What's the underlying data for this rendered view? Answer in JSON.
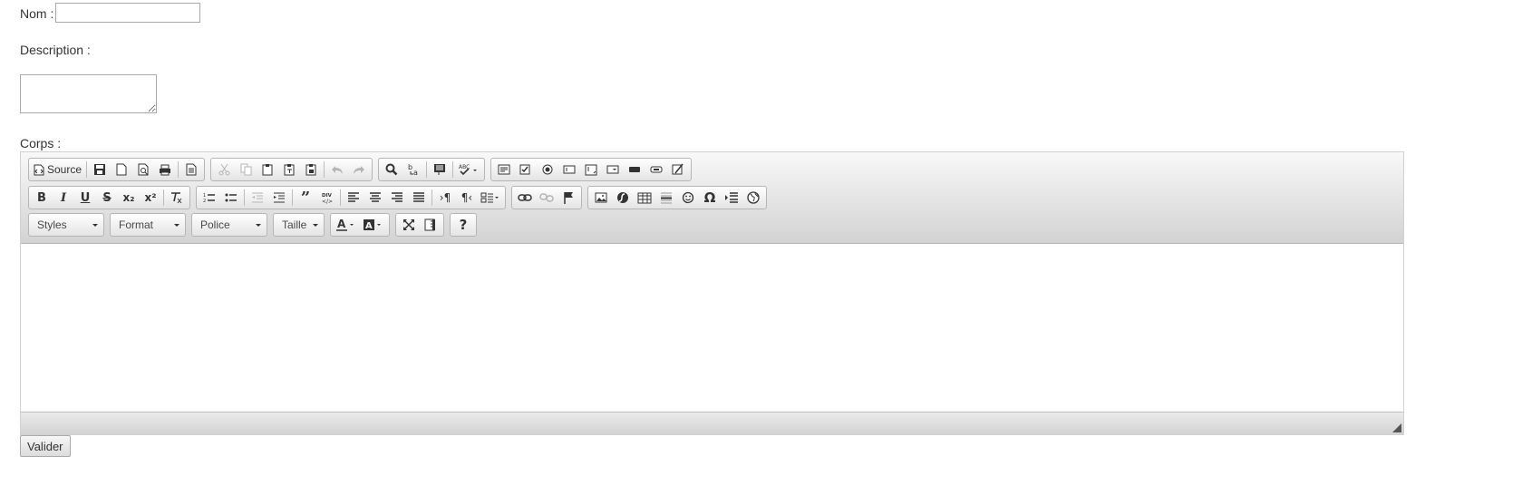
{
  "form": {
    "nom_label": "Nom :",
    "nom_value": "",
    "description_label": "Description :",
    "description_value": "",
    "corps_label": "Corps :",
    "submit_label": "Valider"
  },
  "editor": {
    "toolbar": {
      "source_label": "Source",
      "combos": {
        "styles": "Styles",
        "format": "Format",
        "police": "Police",
        "taille": "Taille"
      },
      "subscript_glyph": "x₂",
      "superscript_glyph": "x²",
      "omega_glyph": "Ω",
      "help_glyph": "?"
    },
    "icons": [
      "source-icon",
      "save-icon",
      "new-page-icon",
      "preview-icon",
      "print-icon",
      "templates-icon",
      "cut-icon",
      "copy-icon",
      "paste-icon",
      "paste-text-icon",
      "paste-word-icon",
      "undo-icon",
      "redo-icon",
      "find-icon",
      "replace-icon",
      "select-all-icon",
      "spellcheck-icon",
      "form-icon",
      "checkbox-icon",
      "radio-icon",
      "text-field-icon",
      "textarea-icon",
      "select-icon",
      "button-icon",
      "image-button-icon",
      "hidden-field-icon",
      "bold-icon",
      "italic-icon",
      "underline-icon",
      "strike-icon",
      "subscript-icon",
      "superscript-icon",
      "remove-format-icon",
      "numbered-list-icon",
      "bulleted-list-icon",
      "outdent-icon",
      "indent-icon",
      "blockquote-icon",
      "div-icon",
      "align-left-icon",
      "align-center-icon",
      "align-right-icon",
      "justify-icon",
      "ltr-icon",
      "rtl-icon",
      "language-icon",
      "link-icon",
      "unlink-icon",
      "anchor-icon",
      "image-icon",
      "flash-icon",
      "table-icon",
      "horizontal-rule-icon",
      "smiley-icon",
      "special-char-icon",
      "page-break-icon",
      "iframe-icon",
      "text-color-icon",
      "bg-color-icon",
      "maximize-icon",
      "show-blocks-icon",
      "help-icon"
    ]
  }
}
